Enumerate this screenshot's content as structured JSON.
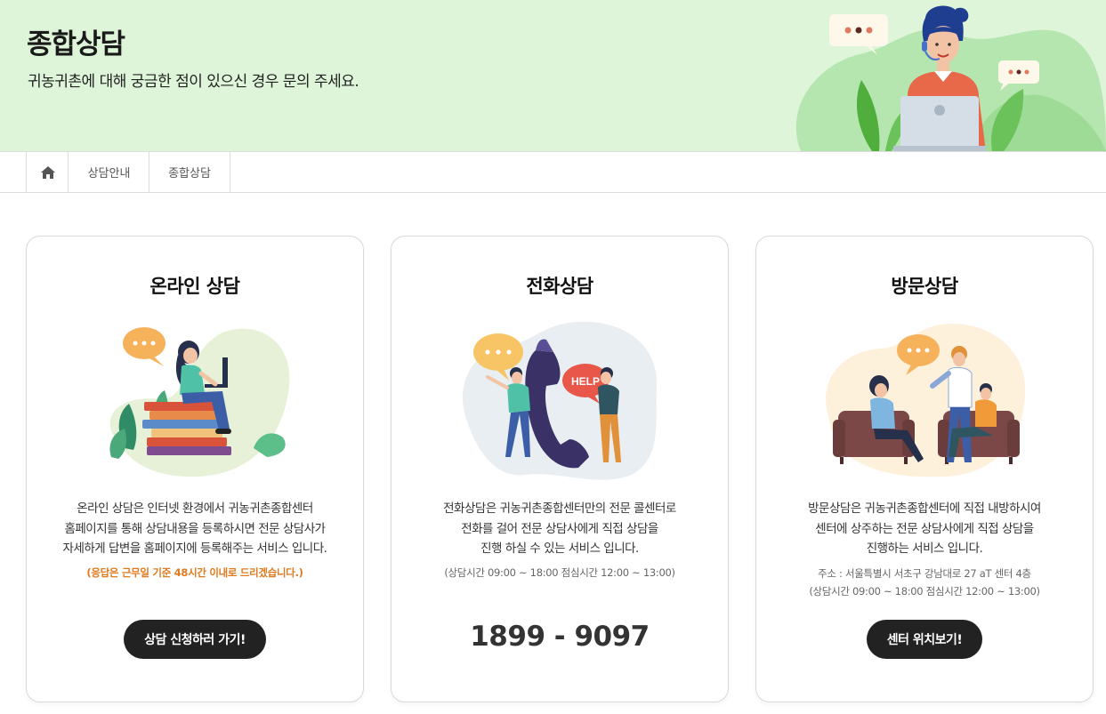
{
  "banner": {
    "title": "종합상담",
    "subtitle": "귀농귀촌에 대해 궁금한 점이 있으신 경우 문의 주세요."
  },
  "breadcrumb": {
    "home_icon": "home-icon",
    "items": [
      "상담안내",
      "종합상담"
    ]
  },
  "cards": {
    "online": {
      "title": "온라인 상담",
      "desc": [
        "온라인 상담은 인터넷 환경에서 귀농귀촌종합센터",
        "홈페이지를 통해 상담내용을 등록하시면 전문 상담사가",
        "자세하게 답변을 홈페이지에 등록해주는 서비스 입니다."
      ],
      "note": "(응답은 근무일 기준 48시간 이내로 드리겠습니다.)",
      "button": "상담 신청하러 가기!"
    },
    "phone": {
      "title": "전화상담",
      "desc": [
        "전화상담은 귀농귀촌종합센터만의 전문 콜센터로",
        "전화를 걸어 전문 상담사에게 직접 상담을",
        "진행 하실 수 있는 서비스 입니다."
      ],
      "note": "(상담시간 09:00 ~ 18:00 점심시간 12:00 ~ 13:00)",
      "bubble_text": "HELP",
      "number": "1899 - 9097"
    },
    "visit": {
      "title": "방문상담",
      "desc": [
        "방문상담은 귀농귀촌종합센터에 직접 내방하시여",
        "센터에 상주하는 전문 상담사에게 직접 상담을",
        "진행하는 서비스 입니다."
      ],
      "address": "주소 : 서울특별시 서초구 강남대로 27 aT 센터 4층",
      "hours": "(상담시간 09:00 ~ 18:00 점심시간 12:00 ~ 13:00)",
      "button": "센터 위치보기!"
    }
  },
  "colors": {
    "banner_bg": "#def5da",
    "button_bg": "#222222",
    "note_orange": "#e07a1d"
  }
}
